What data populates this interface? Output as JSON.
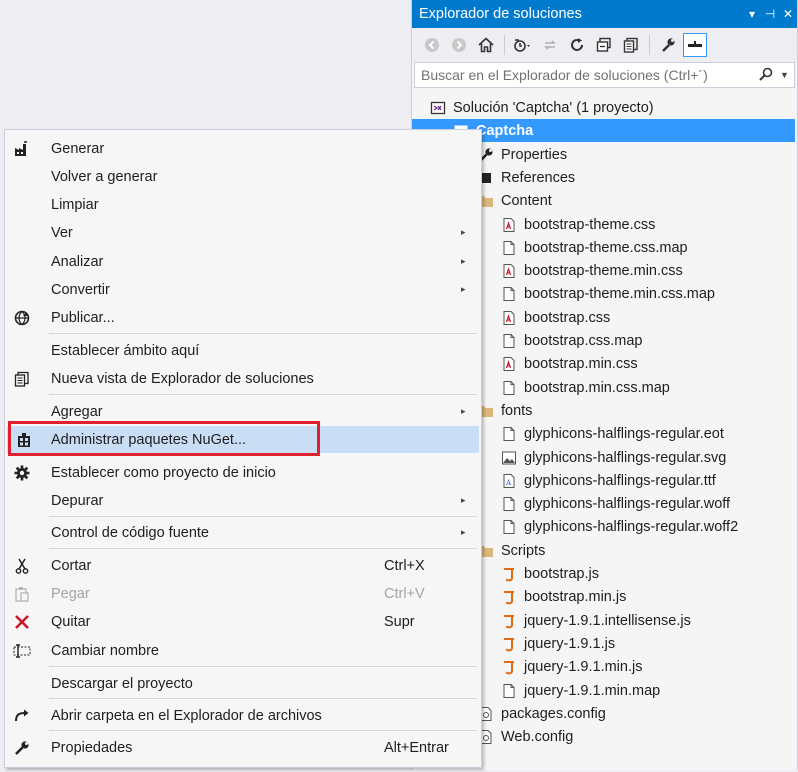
{
  "solution_explorer": {
    "title": "Explorador de soluciones",
    "title_buttons": [
      "▾",
      "⊣",
      "✕"
    ],
    "search_placeholder": "Buscar en el Explorador de soluciones (Ctrl+´)",
    "toolbar_icons": [
      "back-icon",
      "forward-icon",
      "home-icon",
      "history-icon",
      "sync-icon",
      "refresh-icon",
      "collapse-all-icon",
      "show-all-files-icon",
      "properties-icon",
      "preview-icon"
    ],
    "tree": {
      "solution": "Solución 'Captcha'  (1 proyecto)",
      "project": "Captcha",
      "properties": "Properties",
      "references": "References",
      "content_folder": "Content",
      "content_files": [
        "bootstrap-theme.css",
        "bootstrap-theme.css.map",
        "bootstrap-theme.min.css",
        "bootstrap-theme.min.css.map",
        "bootstrap.css",
        "bootstrap.css.map",
        "bootstrap.min.css",
        "bootstrap.min.css.map"
      ],
      "fonts_folder": "fonts",
      "font_files": [
        "glyphicons-halflings-regular.eot",
        "glyphicons-halflings-regular.svg",
        "glyphicons-halflings-regular.ttf",
        "glyphicons-halflings-regular.woff",
        "glyphicons-halflings-regular.woff2"
      ],
      "scripts_folder": "Scripts",
      "script_files": [
        "bootstrap.js",
        "bootstrap.min.js",
        "jquery-1.9.1.intellisense.js",
        "jquery-1.9.1.js",
        "jquery-1.9.1.min.js",
        "jquery-1.9.1.min.map"
      ],
      "packages_config": "packages.config",
      "web_config": "Web.config"
    }
  },
  "context_menu": {
    "generar": "Generar",
    "volver_generar": "Volver a generar",
    "limpiar": "Limpiar",
    "ver": "Ver",
    "analizar": "Analizar",
    "convertir": "Convertir",
    "publicar": "Publicar...",
    "establecer_ambito": "Establecer ámbito aquí",
    "nueva_vista": "Nueva vista de Explorador de soluciones",
    "agregar": "Agregar",
    "nuget": "Administrar paquetes NuGet...",
    "proyecto_inicio": "Establecer como proyecto de inicio",
    "depurar": "Depurar",
    "control_codigo": "Control de código fuente",
    "cortar": "Cortar",
    "cortar_sc": "Ctrl+X",
    "pegar": "Pegar",
    "pegar_sc": "Ctrl+V",
    "quitar": "Quitar",
    "quitar_sc": "Supr",
    "cambiar_nombre": "Cambiar nombre",
    "descargar": "Descargar el proyecto",
    "abrir_carpeta": "Abrir carpeta en el Explorador de archivos",
    "propiedades": "Propiedades",
    "propiedades_sc": "Alt+Entrar",
    "submenu_arrow": "▸"
  },
  "colors": {
    "accent": "#007acc",
    "selection": "#3399ff",
    "menu_highlight": "#c9def5",
    "annotation_box": "#e0202e"
  }
}
